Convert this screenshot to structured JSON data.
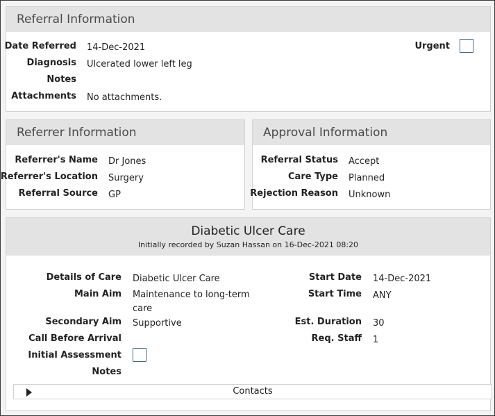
{
  "referral": {
    "title": "Referral Information",
    "date_referred_label": "Date Referred",
    "date_referred": "14-Dec-2021",
    "diagnosis_label": "Diagnosis",
    "diagnosis": "Ulcerated lower left leg",
    "notes_label": "Notes",
    "notes": "",
    "attachments_label": "Attachments",
    "attachments": "No attachments.",
    "urgent_label": "Urgent",
    "urgent_checked": false
  },
  "referrer": {
    "title": "Referrer Information",
    "name_label": "Referrer's Name",
    "name": "Dr Jones",
    "location_label": "Referrer's Location",
    "location": "Surgery",
    "source_label": "Referral Source",
    "source": "GP"
  },
  "approval": {
    "title": "Approval Information",
    "status_label": "Referral Status",
    "status": "Accept",
    "care_type_label": "Care Type",
    "care_type": "Planned",
    "rejection_label": "Rejection Reason",
    "rejection": "Unknown"
  },
  "care": {
    "title": "Diabetic Ulcer Care",
    "subtitle": "Initially recorded by Suzan Hassan on 16-Dec-2021 08:20",
    "details_label": "Details of Care",
    "details": "Diabetic Ulcer Care",
    "main_aim_label": "Main Aim",
    "main_aim": "Maintenance to long-term care",
    "secondary_aim_label": "Secondary Aim",
    "secondary_aim": "Supportive",
    "call_before_label": "Call Before Arrival",
    "call_before": "",
    "initial_assessment_label": "Initial Assessment",
    "initial_assessment_checked": false,
    "notes_label": "Notes",
    "notes": "",
    "start_date_label": "Start Date",
    "start_date": "14-Dec-2021",
    "start_time_label": "Start Time",
    "start_time": "ANY",
    "est_duration_label": "Est. Duration",
    "est_duration": "30",
    "req_staff_label": "Req. Staff",
    "req_staff": "1",
    "contacts_label": "Contacts"
  }
}
